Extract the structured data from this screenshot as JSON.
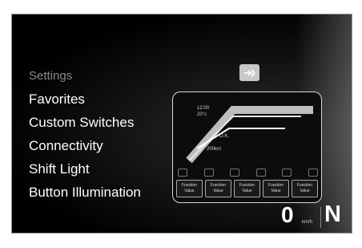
{
  "menu": {
    "items": [
      {
        "label": "Settings",
        "muted": true
      },
      {
        "label": "Favorites",
        "muted": false
      },
      {
        "label": "Custom Switches",
        "muted": false
      },
      {
        "label": "Connectivity",
        "muted": false
      },
      {
        "label": "Shift Light",
        "muted": false
      },
      {
        "label": "Button Illumination",
        "muted": false
      }
    ]
  },
  "enter_icon": "enter-arrow-icon",
  "preview": {
    "time": "12:00",
    "temp": "20°c",
    "odo": "O.K.",
    "trip": "200km",
    "cells": [
      {
        "line1": "Function",
        "line2": "Value"
      },
      {
        "line1": "Function",
        "line2": "Value"
      },
      {
        "line1": "Function",
        "line2": "Value"
      },
      {
        "line1": "Function",
        "line2": "Value"
      },
      {
        "line1": "Function",
        "line2": "Value"
      }
    ]
  },
  "status": {
    "speed": "0",
    "speed_unit": "km/h",
    "gear": "N"
  }
}
